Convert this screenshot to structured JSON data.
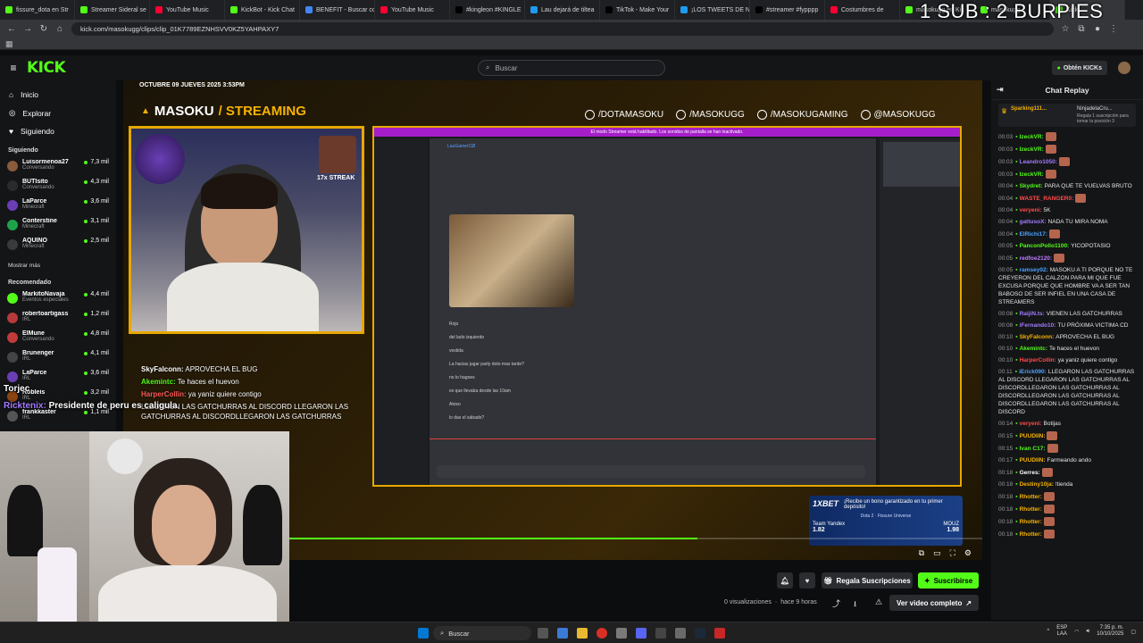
{
  "browser": {
    "tabs": [
      {
        "label": "fissure_dota en Str",
        "color": "#53fc18"
      },
      {
        "label": "Streamer Sideral se",
        "color": "#53fc18"
      },
      {
        "label": "YouTube Music",
        "color": "#ff0033"
      },
      {
        "label": "KickBot - Kick Chat",
        "color": "#53fc18"
      },
      {
        "label": "BENEFIT - Buscar co",
        "color": "#4285f4"
      },
      {
        "label": "YouTube Music",
        "color": "#ff0033"
      },
      {
        "label": "#kingleon #KINGLE",
        "color": "#000000"
      },
      {
        "label": "Lau dejará de tiltea",
        "color": "#1d9bf0"
      },
      {
        "label": "TikTok - Make Your",
        "color": "#000000"
      },
      {
        "label": "¡LOS TWEETS DE N",
        "color": "#1d9bf0"
      },
      {
        "label": "#streamer #fypppp",
        "color": "#000000"
      },
      {
        "label": "Costumbres de",
        "color": "#ff0033"
      },
      {
        "label": "masokugg en Kic",
        "color": "#53fc18"
      },
      {
        "label": "masokugg",
        "color": "#53fc18"
      },
      {
        "label": "Kick",
        "color": "#53fc18"
      }
    ],
    "url": "kick.com/masokugg/clips/clip_01K7789EZNHSVV0KZ5YAHPAXY7",
    "overlay_text": "1 SUB : 2 BURPIES"
  },
  "kick": {
    "logo": "KICK",
    "search_placeholder": "Buscar",
    "get_kicks": "Obtén KICKs"
  },
  "sidebar": {
    "nav": [
      {
        "label": "Inicio",
        "icon": "home-icon"
      },
      {
        "label": "Explorar",
        "icon": "compass-icon"
      },
      {
        "label": "Siguiendo",
        "icon": "heart-icon"
      }
    ],
    "following_title": "Siguiendo",
    "following": [
      {
        "name": "Luisormenoa27",
        "sub": "Conversando",
        "viewers": "7,3 mil",
        "color": "#8a5a3a"
      },
      {
        "name": "BUTIsito",
        "sub": "Conversando",
        "viewers": "4,3 mil",
        "color": "#2b2b2b"
      },
      {
        "name": "LaParce",
        "sub": "Minecraft",
        "viewers": "3,6 mil",
        "color": "#6a3fb5"
      },
      {
        "name": "Conterstine",
        "sub": "Minecraft",
        "viewers": "3,1 mil",
        "color": "#1fa34a"
      },
      {
        "name": "AQUINO",
        "sub": "Minecraft",
        "viewers": "2,5 mil",
        "color": "#3a3a3a"
      }
    ],
    "show_more": "Mostrar más",
    "recommended_title": "Recomendado",
    "recommended": [
      {
        "name": "MarkitoNavaja",
        "sub": "Eventos especiales",
        "viewers": "4,4 mil",
        "color": "#53fc18"
      },
      {
        "name": "robertoartigass",
        "sub": "IRL",
        "viewers": "1,2 mil",
        "color": "#b73a3a"
      },
      {
        "name": "ElMune",
        "sub": "Conversando",
        "viewers": "4,8 mil",
        "color": "#c23b3b"
      },
      {
        "name": "Brunenger",
        "sub": "IRL",
        "viewers": "4,1 mil",
        "color": "#444444"
      },
      {
        "name": "LaParce",
        "sub": "IRL",
        "viewers": "3,6 mil",
        "color": "#6a3fb5"
      },
      {
        "name": "Robleis",
        "sub": "IRL",
        "viewers": "3,2 mil",
        "color": "#8b4513"
      },
      {
        "name": "frankkaster",
        "sub": "IRL",
        "viewers": "1,1 mil",
        "color": "#555555"
      }
    ]
  },
  "player": {
    "date": "OCTUBRE 09 JUEVES 2025 3:53PM",
    "title_a": "MASOKU",
    "title_b": "/ STREAMING",
    "socials": [
      "/DOTAMASOKU",
      "/MASOKUGG",
      "/MASOKUGAMING",
      "@MASOKUGG"
    ],
    "streak": "17x STREAK",
    "overlay_chat": [
      {
        "user": "SkyFalconn:",
        "msg": "APROVECHA EL BUG",
        "color": "#ffffff"
      },
      {
        "user": "Akemintc:",
        "msg": "Te haces el huevon",
        "color": "#53fc18"
      },
      {
        "user": "HarperCollin:",
        "msg": "ya yaniz quiere contigo",
        "color": "#ff5a5a"
      },
      {
        "user": "",
        "msg": "LLEGARON LAS GATCHURRAS AL DISCORD LLEGARON LAS GATCHURRAS AL DISCORDLLEGARON LAS GATCHURRAS",
        "color": "#ffffff"
      }
    ],
    "left_overlay_1": "Torjec",
    "left_overlay_2": "Ricktenix:",
    "left_overlay_2_msg": "Presidente de peru es caligula",
    "ad_line1": "¡Recibe un bono garantizado en tu primer depósito!",
    "ad_brand": "1XBET",
    "ad_match": "Dota 2 · Fissure Universe",
    "ad_team1": "Team Yandex",
    "ad_team2": "MOUZ",
    "ad_odd1": "1.82",
    "ad_odd2": "1.98",
    "progress": 0.59,
    "screen_banner": "El modo Streamer está habilitado. Los sonidos de pantalla se han inactivado.",
    "screen_user": "LauGamerCØ",
    "screen_msgs": [
      "Rojo",
      "del lado izquierdo",
      "vestida",
      "La hacias jugar party doto mas tarde?",
      "no lo hagoes",
      "es que llevaba desde las 10am",
      "Atoso",
      "lo das el sábado?"
    ]
  },
  "below": {
    "views": "0 visualizaciones",
    "ago": "hace 9 horas",
    "gift": "Regala Suscripciones",
    "subscribe": "Suscribirse",
    "full_video": "Ver video completo"
  },
  "chat": {
    "title": "Chat Replay",
    "pinned_user": "Sparking111...",
    "pinned_user2": "NinjadelaCru...",
    "pinned_text": "Regala 1 suscripción para tomar la posición 3",
    "messages": [
      {
        "t": "00:03",
        "u": "IzeckVR:",
        "m": "",
        "c": "#53fc18"
      },
      {
        "t": "00:03",
        "u": "IzeckVR:",
        "m": "",
        "c": "#53fc18"
      },
      {
        "t": "00:03",
        "u": "Leandro1050:",
        "m": "",
        "c": "#a37bff"
      },
      {
        "t": "00:03",
        "u": "IzeckVR:",
        "m": "",
        "c": "#53fc18"
      },
      {
        "t": "00:04",
        "u": "Skydret:",
        "m": "PARA QUE TE VUELVAS BRUTO",
        "c": "#53fc18"
      },
      {
        "t": "00:04",
        "u": "WASTE_RANGER0:",
        "m": "",
        "c": "#ff4d4d"
      },
      {
        "t": "00:04",
        "u": "veryeni:",
        "m": "5K",
        "c": "#ff4d4d"
      },
      {
        "t": "00:04",
        "u": "gattusoX:",
        "m": "NADA TU MIRA NOMA",
        "c": "#a37bff"
      },
      {
        "t": "00:04",
        "u": "ElRichi17:",
        "m": "",
        "c": "#4da3ff"
      },
      {
        "t": "00:05",
        "u": "PanconPollo1100:",
        "m": "YICOPOTASIO",
        "c": "#53fc18"
      },
      {
        "t": "00:05",
        "u": "redfoe2120:",
        "m": "",
        "c": "#c07bff"
      },
      {
        "t": "00:05",
        "u": "ramsey02:",
        "m": "MASOKU A TI PORQUE NO TE CREYERON DEL CALZON PARA MI QUE FUE EXCUSA PORQUE QUE HOMBRE VA A SER TAN BABOSO DE SER INFIEL EN UNA CASA DE STREAMERS",
        "c": "#4da3ff"
      },
      {
        "t": "00:08",
        "u": "RaijiN.ts:",
        "m": "VIENEN LAS GATCHURRAS",
        "c": "#a37bff"
      },
      {
        "t": "00:08",
        "u": "iFernando10:",
        "m": "TU PRÓXIMA VICTIMA CD",
        "c": "#a37bff"
      },
      {
        "t": "00:10",
        "u": "SkyFalconn:",
        "m": "APROVECHA EL BUG",
        "c": "#f5b300"
      },
      {
        "t": "00:10",
        "u": "Akemintc:",
        "m": "Te haces el huevon",
        "c": "#53fc18"
      },
      {
        "t": "00:10",
        "u": "HarperCollin:",
        "m": "ya yaniz quiere contigo",
        "c": "#ff4d4d"
      },
      {
        "t": "00:11",
        "u": "iErick090:",
        "m": "LLEGARON LAS GATCHURRAS AL DISCORD LLEGARON LAS GATCHURRAS AL DISCORDLLEGARON LAS GATCHURRAS AL DISCORDLLEGARON LAS GATCHURRAS AL DISCORDLLEGARON LAS GATCHURRAS AL DISCORD",
        "c": "#4da3ff"
      },
      {
        "t": "00:14",
        "u": "veryeni:",
        "m": "Botijas",
        "c": "#ff4d4d"
      },
      {
        "t": "00:15",
        "u": "PUUDIIN:",
        "m": "",
        "c": "#f5b300"
      },
      {
        "t": "00:15",
        "u": "Ivan C17:",
        "m": "",
        "c": "#53fc18"
      },
      {
        "t": "00:17",
        "u": "PUUDIIN:",
        "m": "Farmeando ando",
        "c": "#f5b300"
      },
      {
        "t": "00:18",
        "u": "Gerres:",
        "m": "",
        "c": "#ffffff"
      },
      {
        "t": "00:18",
        "u": "Destiny10ja:",
        "m": "!tienda",
        "c": "#f5b300"
      },
      {
        "t": "00:18",
        "u": "Rhotter:",
        "m": "",
        "c": "#f5b300"
      },
      {
        "t": "00:18",
        "u": "Rhotter:",
        "m": "",
        "c": "#f5b300"
      },
      {
        "t": "00:18",
        "u": "Rhotter:",
        "m": "",
        "c": "#f5b300"
      },
      {
        "t": "00:18",
        "u": "Rhotter:",
        "m": "",
        "c": "#f5b300"
      }
    ]
  },
  "taskbar": {
    "search": "Buscar",
    "lang": "ESP",
    "lang2": "LAA",
    "time": "7:35 p. m.",
    "date": "10/10/2025"
  }
}
